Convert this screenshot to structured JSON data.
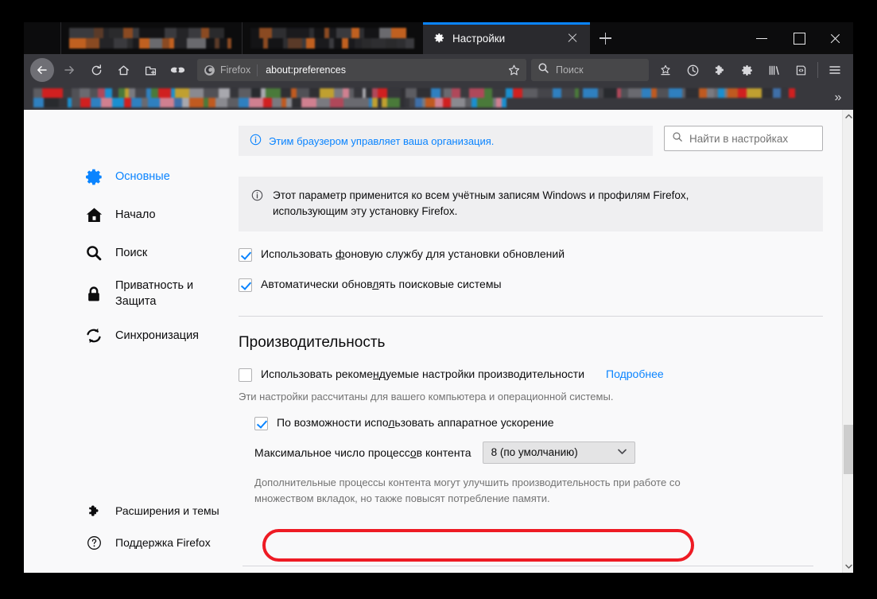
{
  "window": {
    "controls": {
      "minimize": "—",
      "maximize": "□",
      "close": "✕"
    }
  },
  "tabs": {
    "background_tabs": [
      {
        "title": "",
        "blurred": true
      },
      {
        "title": "",
        "blurred": true
      }
    ],
    "active_tab": {
      "title": "Настройки",
      "favicon": "gear-icon",
      "close_label": "✕"
    },
    "new_tab_label": "+"
  },
  "toolbar": {
    "back": "back-arrow-icon",
    "forward": "forward-arrow-icon",
    "reload": "reload-icon",
    "home": "home-icon",
    "container_tab": "new-container-tab-icon",
    "private": "mask-icon",
    "url": {
      "identity_label": "Firefox",
      "value": "about:preferences",
      "bookmark_star": "star-icon"
    },
    "search": {
      "placeholder": "Поиск",
      "icon": "search-icon"
    },
    "icons": [
      "bookmark-toolbar-icon",
      "history-clock-icon",
      "extensions-puzzle-icon",
      "settings-gear-icon",
      "library-icon",
      "reader-view-icon"
    ],
    "menu": "hamburger-menu-icon"
  },
  "bookmarks_bar": {
    "blurred": true,
    "overflow_label": "»"
  },
  "sidebar": {
    "items": [
      {
        "label": "Основные",
        "icon": "gear-icon",
        "active": true
      },
      {
        "label": "Начало",
        "icon": "home-icon",
        "active": false
      },
      {
        "label": "Поиск",
        "icon": "search-icon",
        "active": false
      },
      {
        "label_line1": "Приватность и",
        "label_line2": "Защита",
        "icon": "lock-icon",
        "active": false
      },
      {
        "label": "Синхронизация",
        "icon": "sync-icon",
        "active": false
      }
    ],
    "bottom_items": [
      {
        "label": "Расширения и темы",
        "icon": "puzzle-icon"
      },
      {
        "label": "Поддержка Firefox",
        "icon": "help-circle-icon"
      }
    ]
  },
  "main": {
    "enterprise_notice": {
      "icon": "info-icon",
      "text": "Этим браузером управляет ваша организация."
    },
    "find_in_settings": {
      "icon": "search-icon",
      "placeholder": "Найти в настройках"
    },
    "info_box": {
      "icon": "info-icon",
      "line1": "Этот параметр применится ко всем учётным записям Windows и профилям Firefox,",
      "line2": "использующим эту установку Firefox."
    },
    "checkboxes": [
      {
        "label": "Использовать фоновую службу для установки обновлений",
        "checked": true
      },
      {
        "label": "Автоматически обновлять поисковые системы",
        "checked": true
      }
    ],
    "performance": {
      "title": "Производительность",
      "recommended": {
        "label": "Использовать рекомендуемые настройки производительности",
        "checked": false,
        "link": "Подробнее"
      },
      "hint": "Эти настройки рассчитаны для вашего компьютера и операционной системы.",
      "hardware_acceleration": {
        "label": "По возможности использовать аппаратное ускорение",
        "checked": true,
        "highlighted": true
      },
      "content_processes": {
        "label": "Максимальное число процессов контента",
        "value": "8 (по умолчанию)",
        "chevron": "⌄"
      },
      "processes_hint_line1": "Дополнительные процессы контента могут улучшить производительность при работе со",
      "processes_hint_line2": "множеством вкладок, но также повысят потребление памяти."
    }
  },
  "scrollbar": {
    "up_arrow": "⌃",
    "down_arrow": "⌄"
  },
  "colors": {
    "accent_blue": "#0a84ff",
    "highlight_red": "#ee1b24",
    "chrome_dark": "#38383d",
    "tabstrip_dark": "#0c0c0d",
    "page_bg": "#f9f9fa"
  }
}
